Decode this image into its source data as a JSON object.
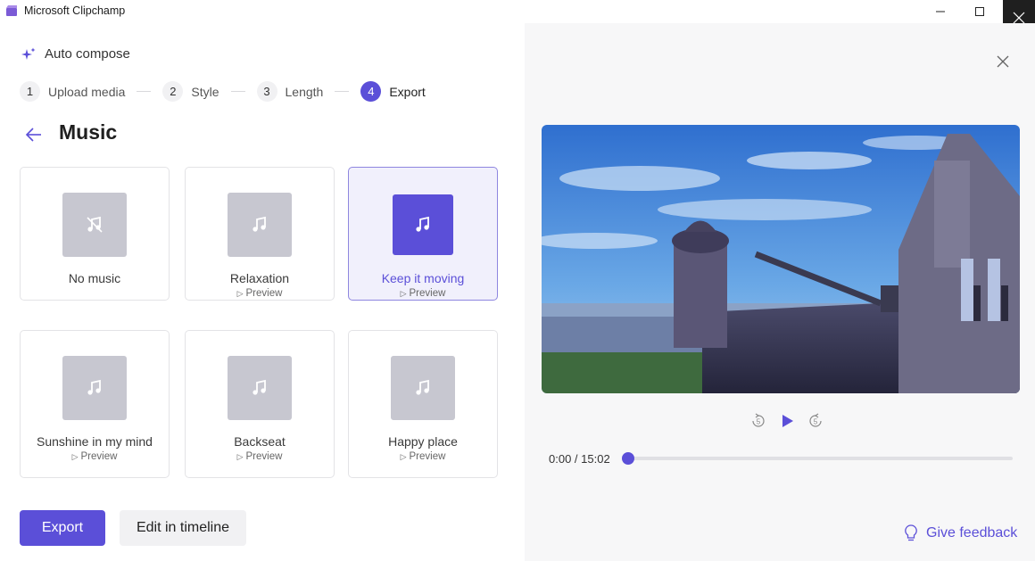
{
  "window": {
    "title": "Microsoft Clipchamp"
  },
  "header": {
    "auto_compose": "Auto compose"
  },
  "steps": [
    {
      "num": "1",
      "label": "Upload media"
    },
    {
      "num": "2",
      "label": "Style"
    },
    {
      "num": "3",
      "label": "Length"
    },
    {
      "num": "4",
      "label": "Export"
    }
  ],
  "page": {
    "title": "Music"
  },
  "music_options": [
    {
      "label": "No music",
      "preview": ""
    },
    {
      "label": "Relaxation",
      "preview": "Preview"
    },
    {
      "label": "Keep it moving",
      "preview": "Preview"
    },
    {
      "label": "Sunshine in my mind",
      "preview": "Preview"
    },
    {
      "label": "Backseat",
      "preview": "Preview"
    },
    {
      "label": "Happy place",
      "preview": "Preview"
    }
  ],
  "actions": {
    "export_label": "Export",
    "edit_label": "Edit in timeline"
  },
  "player": {
    "time": "0:00 / 15:02",
    "progress": 0,
    "rewind_seconds": "5",
    "forward_seconds": "5"
  },
  "feedback": {
    "label": "Give feedback"
  },
  "colors": {
    "accent": "#5b4fd8",
    "thumb": "#c7c7d0",
    "selected_bg": "#f1f0fc"
  }
}
